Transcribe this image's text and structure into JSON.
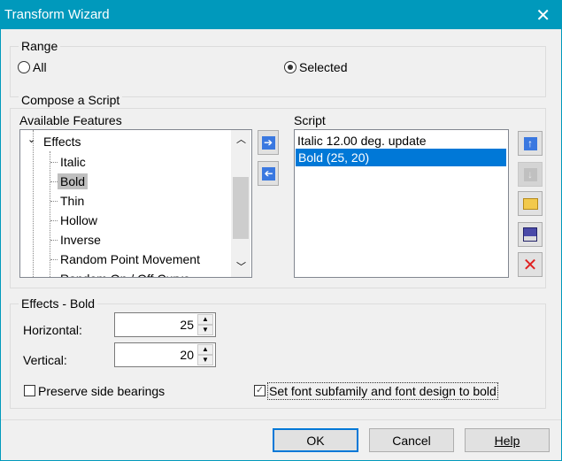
{
  "window": {
    "title": "Transform Wizard",
    "close_icon": "close-icon"
  },
  "range": {
    "label": "Range",
    "options": [
      {
        "label": "All",
        "selected": false
      },
      {
        "label": "Selected",
        "selected": true
      }
    ]
  },
  "compose": {
    "label": "Compose a Script",
    "available_label": "Available Features",
    "script_label": "Script",
    "tree": {
      "parent": "Effects",
      "items": [
        "Italic",
        "Bold",
        "Thin",
        "Hollow",
        "Inverse",
        "Random Point Movement",
        "Random On / Off Curve"
      ],
      "selected": "Bold"
    },
    "script_items": [
      "Italic 12.00 deg.  update",
      "Bold (25, 20)"
    ],
    "script_selected": "Bold (25, 20)"
  },
  "effects": {
    "label": "Effects - Bold",
    "horizontal_label": "Horizontal:",
    "horizontal": "25",
    "vertical_label": "Vertical:",
    "vertical": "20",
    "preserve_label": "Preserve side bearings",
    "preserve_checked": false,
    "subfamily_label": "Set font subfamily and font design to bold",
    "subfamily_checked": true
  },
  "buttons": {
    "ok": "OK",
    "cancel": "Cancel",
    "help": "Help"
  },
  "colors": {
    "titlebar": "#0099bc",
    "selection": "#0078d7",
    "tree_selection": "#bfbfbf"
  }
}
